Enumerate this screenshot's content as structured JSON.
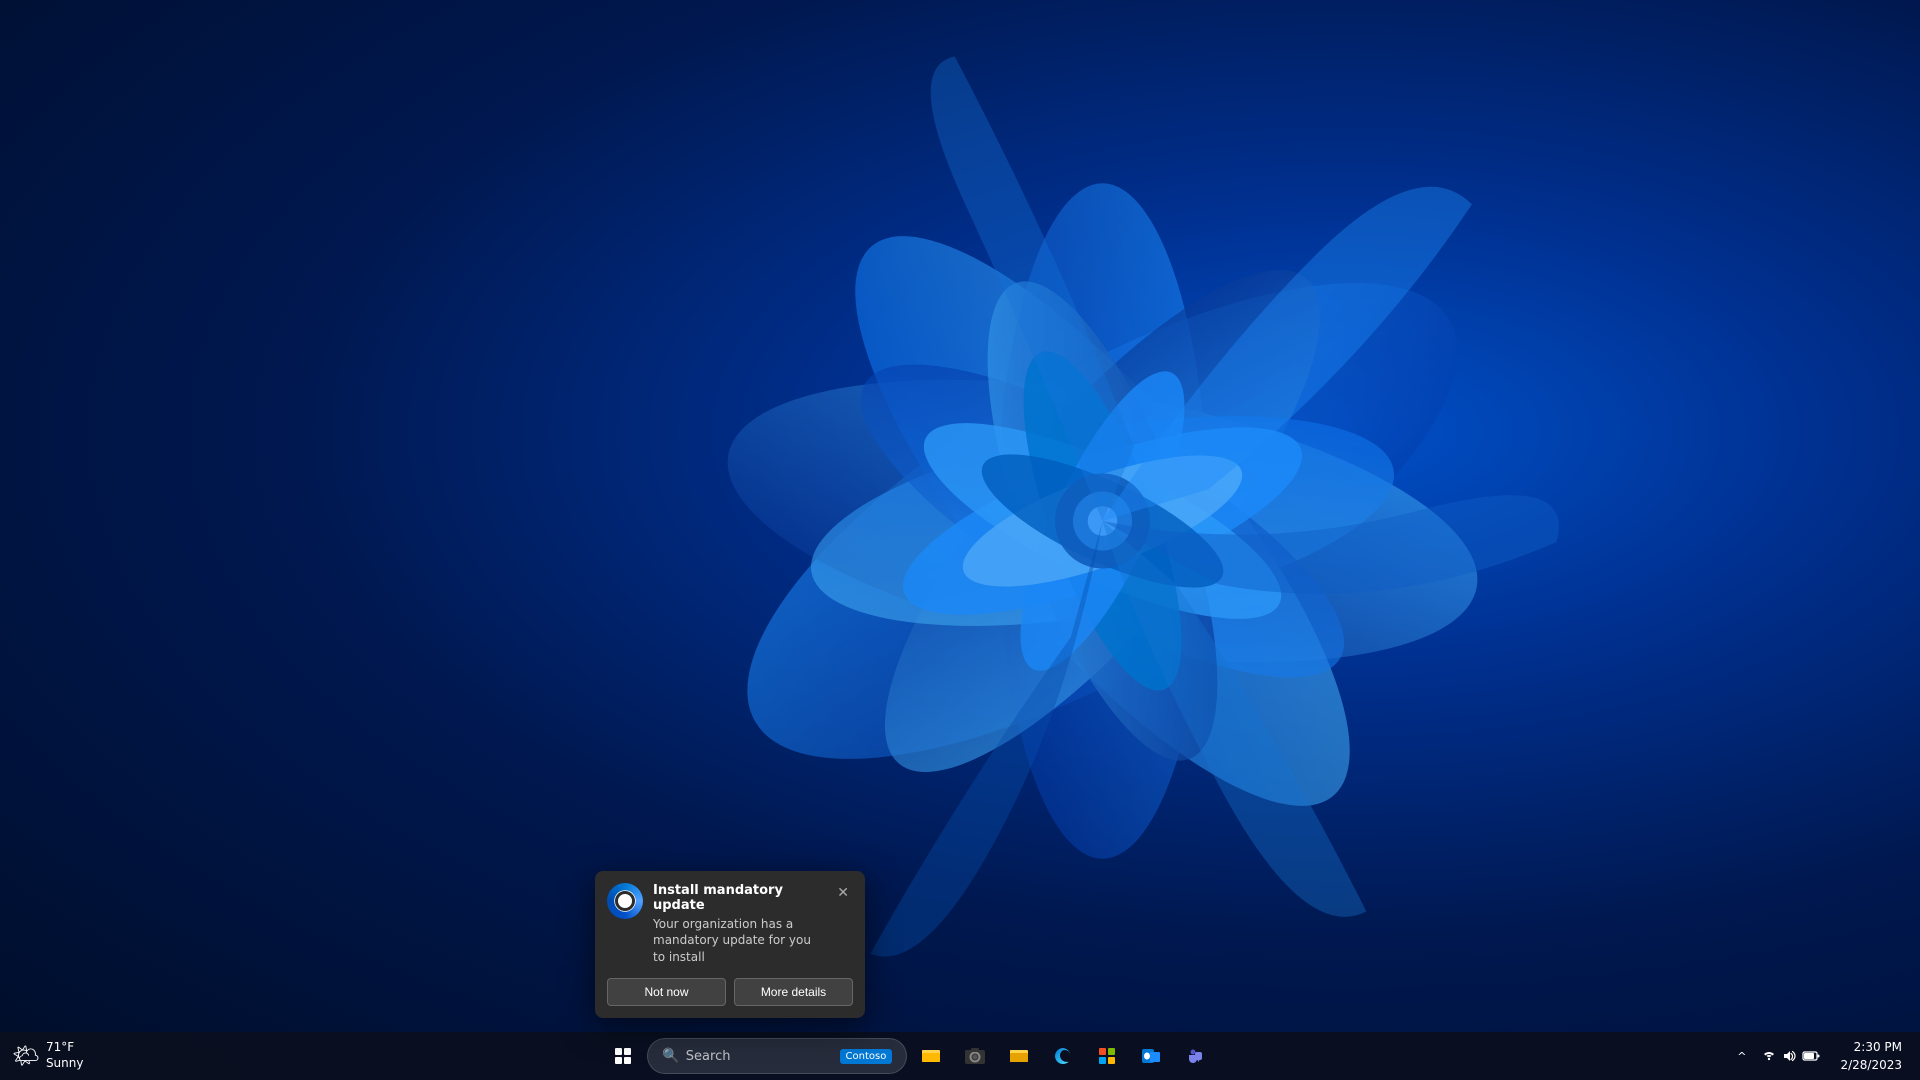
{
  "desktop": {
    "wallpaper_description": "Windows 11 bloom blue abstract wallpaper"
  },
  "taskbar": {
    "start_label": "Start",
    "search_placeholder": "Search",
    "weather": {
      "temp": "71°F",
      "condition": "Sunny"
    },
    "apps": [
      {
        "name": "file-explorer",
        "icon": "🗂",
        "label": "File Explorer"
      },
      {
        "name": "teams",
        "icon": "🎦",
        "label": "Microsoft Teams"
      },
      {
        "name": "file-manager",
        "icon": "📁",
        "label": "File Manager"
      },
      {
        "name": "edge",
        "icon": "🌐",
        "label": "Microsoft Edge"
      },
      {
        "name": "store",
        "icon": "🛍",
        "label": "Microsoft Store"
      },
      {
        "name": "outlook",
        "icon": "📧",
        "label": "Outlook"
      },
      {
        "name": "teams2",
        "icon": "💬",
        "label": "Teams"
      }
    ],
    "contoso_label": "Contoso",
    "tray": {
      "chevron": "^",
      "network_icon": "wifi",
      "volume_icon": "🔊",
      "battery_icon": "🔋"
    },
    "clock": {
      "time": "2:30 PM",
      "date": "2/28/2023"
    }
  },
  "notification": {
    "title": "Install mandatory update",
    "body": "Your organization has a mandatory update for you to install",
    "app_icon_desc": "Windows Update / Intune",
    "buttons": {
      "dismiss": "Not now",
      "action": "More details"
    }
  }
}
